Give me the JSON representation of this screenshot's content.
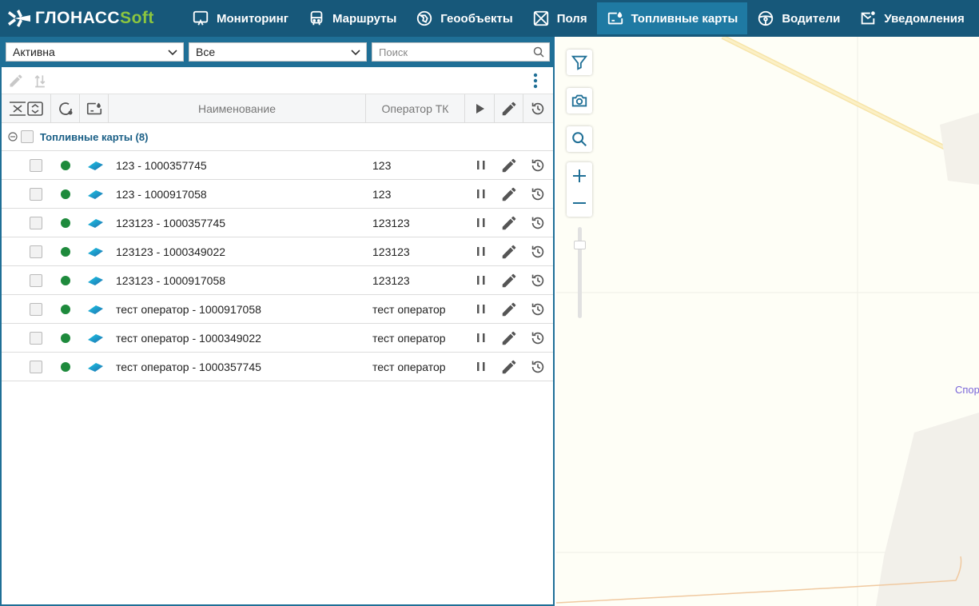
{
  "brand": {
    "name_main": "ГЛОНАСС",
    "name_soft": "Soft"
  },
  "nav": [
    {
      "label": "Мониторинг",
      "icon": "monitoring-icon"
    },
    {
      "label": "Маршруты",
      "icon": "bus-icon"
    },
    {
      "label": "Геообъекты",
      "icon": "geoobject-icon"
    },
    {
      "label": "Поля",
      "icon": "field-icon"
    },
    {
      "label": "Топливные карты",
      "icon": "fuel-card-icon",
      "active": true
    },
    {
      "label": "Водители",
      "icon": "steering-wheel-icon"
    },
    {
      "label": "Уведомления",
      "icon": "notification-icon"
    }
  ],
  "filters": {
    "status_value": "Активна",
    "operator_value": "Все",
    "search_placeholder": "Поиск"
  },
  "table": {
    "headers": {
      "name": "Наименование",
      "operator": "Оператор ТК"
    },
    "group_label": "Топливные карты (8)",
    "rows": [
      {
        "name": "123 - 1000357745",
        "operator": "123"
      },
      {
        "name": "123 - 1000917058",
        "operator": "123"
      },
      {
        "name": "123123 - 1000357745",
        "operator": "123123"
      },
      {
        "name": "123123 - 1000349022",
        "operator": "123123"
      },
      {
        "name": "123123 - 1000917058",
        "operator": "123123"
      },
      {
        "name": "тест оператор - 1000917058",
        "operator": "тест оператор"
      },
      {
        "name": "тест оператор - 1000349022",
        "operator": "тест оператор"
      },
      {
        "name": "тест оператор - 1000357745",
        "operator": "тест оператор"
      }
    ]
  },
  "map": {
    "label_fragment": "Спор"
  },
  "colors": {
    "topbar": "#17587a",
    "active_tab": "#1f7aa3",
    "status_active": "#1e8a3c",
    "brand_soft": "#8cc63f"
  }
}
